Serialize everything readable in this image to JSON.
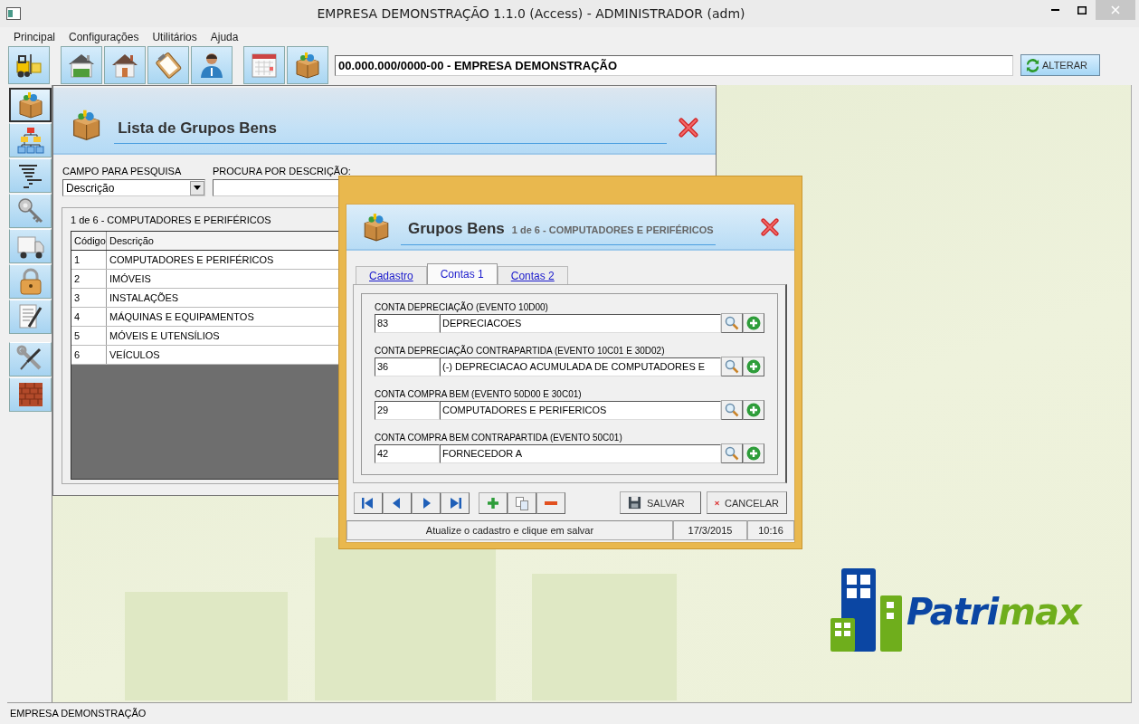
{
  "window": {
    "title": "EMPRESA DEMONSTRAÇÃO 1.1.0 (Access) - ADMINISTRADOR (adm)"
  },
  "menu": [
    "Principal",
    "Configurações",
    "Utilitários",
    "Ajuda"
  ],
  "toolbar": {
    "company": "00.000.000/0000-00 - EMPRESA DEMONSTRAÇÃO",
    "change_button": "ALTERAR"
  },
  "sidebar": {
    "items": [
      {
        "selected": true
      },
      {
        "selected": false
      },
      {
        "selected": false
      },
      {
        "selected": false
      },
      {
        "selected": false
      },
      {
        "selected": false
      },
      {
        "selected": false
      },
      {
        "selected": false
      },
      {
        "selected": false
      }
    ]
  },
  "list_window": {
    "title": "Lista de Grupos Bens",
    "field_label": "CAMPO PARA PESQUISA",
    "field_value": "Descrição",
    "search_label": "PROCURA POR DESCRIÇÃO:",
    "record": "1 de 6 - COMPUTADORES E PERIFÉRICOS",
    "columns": [
      "Código",
      "Descrição"
    ],
    "rows": [
      [
        "1",
        "COMPUTADORES E PERIFÉRICOS"
      ],
      [
        "2",
        "IMÓVEIS"
      ],
      [
        "3",
        "INSTALAÇÕES"
      ],
      [
        "4",
        "MÁQUINAS E EQUIPAMENTOS"
      ],
      [
        "5",
        "MÓVEIS E UTENSÍLIOS"
      ],
      [
        "6",
        "VEÍCULOS"
      ]
    ]
  },
  "dialog": {
    "title": "Grupos Bens",
    "subtitle": "1 de 6 - COMPUTADORES E PERIFÉRICOS",
    "tabs": [
      {
        "label": "Cadastro",
        "selected": false
      },
      {
        "label": "Contas 1",
        "selected": true
      },
      {
        "label": "Contas 2",
        "selected": false
      }
    ],
    "accounts": [
      {
        "label": "CONTA DEPRECIAÇÃO (EVENTO 10D00)",
        "code": "83",
        "name": "DEPRECIACOES"
      },
      {
        "label": "CONTA DEPRECIAÇÃO CONTRAPARTIDA (EVENTO 10C01 E 30D02)",
        "code": "36",
        "name": "(-) DEPRECIACAO ACUMULADA DE COMPUTADORES E"
      },
      {
        "label": "CONTA COMPRA BEM (EVENTO 50D00 E 30C01)",
        "code": "29",
        "name": "COMPUTADORES E PERIFERICOS"
      },
      {
        "label": "CONTA COMPRA BEM CONTRAPARTIDA (EVENTO 50C01)",
        "code": "42",
        "name": "FORNECEDOR A"
      }
    ],
    "save_button": "SALVAR",
    "cancel_button": "CANCELAR",
    "status": {
      "message": "Atualize o cadastro e clique em salvar",
      "date": "17/3/2015",
      "time": "10:16"
    }
  },
  "logo": {
    "parts": [
      {
        "text": "Patri",
        "color": "#0b46a3"
      },
      {
        "text": "max",
        "color": "#6fae1c"
      }
    ]
  },
  "status_bar": "EMPRESA DEMONSTRAÇÃO"
}
